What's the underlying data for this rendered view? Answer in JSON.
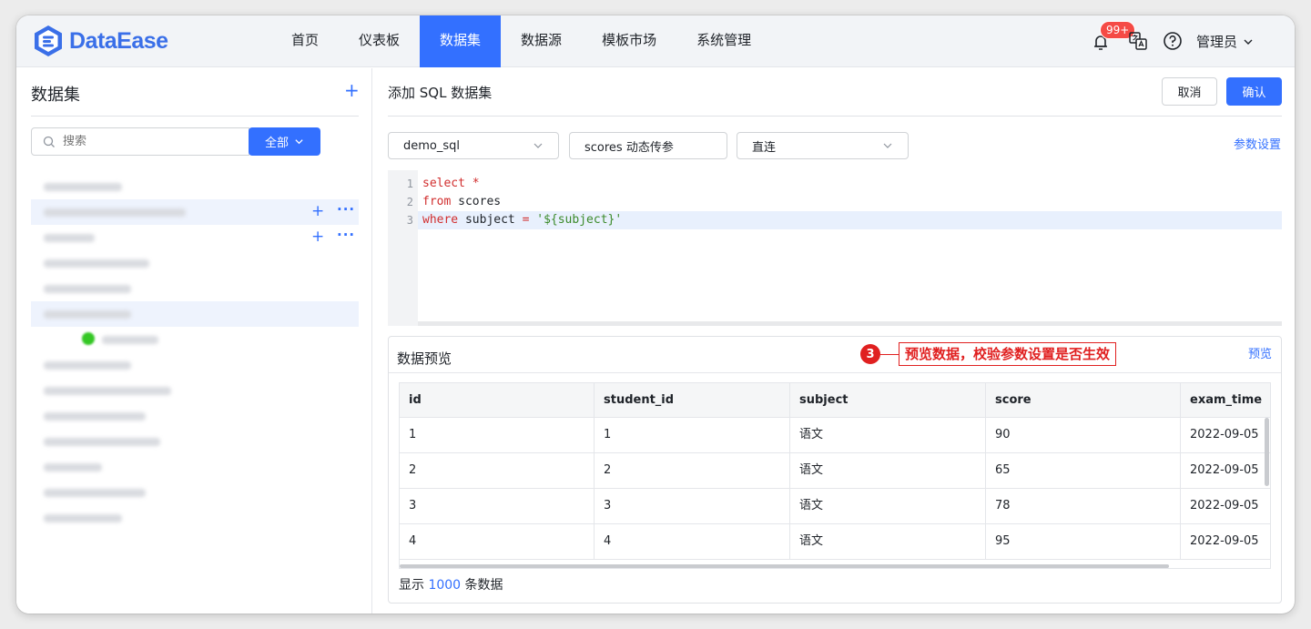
{
  "app": {
    "brand": "DataEase"
  },
  "nav": {
    "items": [
      {
        "label": "首页"
      },
      {
        "label": "仪表板"
      },
      {
        "label": "数据集"
      },
      {
        "label": "数据源"
      },
      {
        "label": "模板市场"
      },
      {
        "label": "系统管理"
      }
    ],
    "active": "数据集"
  },
  "header": {
    "badge": "99+",
    "user": "管理员"
  },
  "sidebar": {
    "title": "数据集",
    "search_placeholder": "搜索",
    "scope_label": "全部"
  },
  "main": {
    "title": "添加 SQL 数据集",
    "cancel_label": "取消",
    "ok_label": "确认",
    "datasource": "demo_sql",
    "table_name": "scores 动态传参",
    "mode": "直连",
    "param_link": "参数设置"
  },
  "editor": {
    "lines": [
      {
        "n": "1",
        "tokens": [
          {
            "t": "select",
            "c": "kw"
          },
          {
            "t": " ",
            "c": "id"
          },
          {
            "t": "*",
            "c": "op"
          }
        ]
      },
      {
        "n": "2",
        "tokens": [
          {
            "t": "from",
            "c": "kw"
          },
          {
            "t": " scores",
            "c": "id"
          }
        ]
      },
      {
        "n": "3",
        "tokens": [
          {
            "t": "where",
            "c": "kw"
          },
          {
            "t": " subject ",
            "c": "id"
          },
          {
            "t": "=",
            "c": "op"
          },
          {
            "t": " ",
            "c": "id"
          },
          {
            "t": "'${subject}'",
            "c": "str"
          }
        ]
      }
    ]
  },
  "preview": {
    "title": "数据预览",
    "link": "预览",
    "callout_num": "3",
    "callout_text": "预览数据，校验参数设置是否生效",
    "columns": [
      "id",
      "student_id",
      "subject",
      "score",
      "exam_time"
    ],
    "rows": [
      [
        "1",
        "1",
        "语文",
        "90",
        "2022-09-05"
      ],
      [
        "2",
        "2",
        "语文",
        "65",
        "2022-09-05"
      ],
      [
        "3",
        "3",
        "语文",
        "78",
        "2022-09-05"
      ],
      [
        "4",
        "4",
        "语文",
        "95",
        "2022-09-05"
      ]
    ],
    "footer_prefix": "显示",
    "footer_count": "1000",
    "footer_suffix": "条数据"
  },
  "colors": {
    "accent": "#3370ff",
    "callout": "#e02020"
  }
}
